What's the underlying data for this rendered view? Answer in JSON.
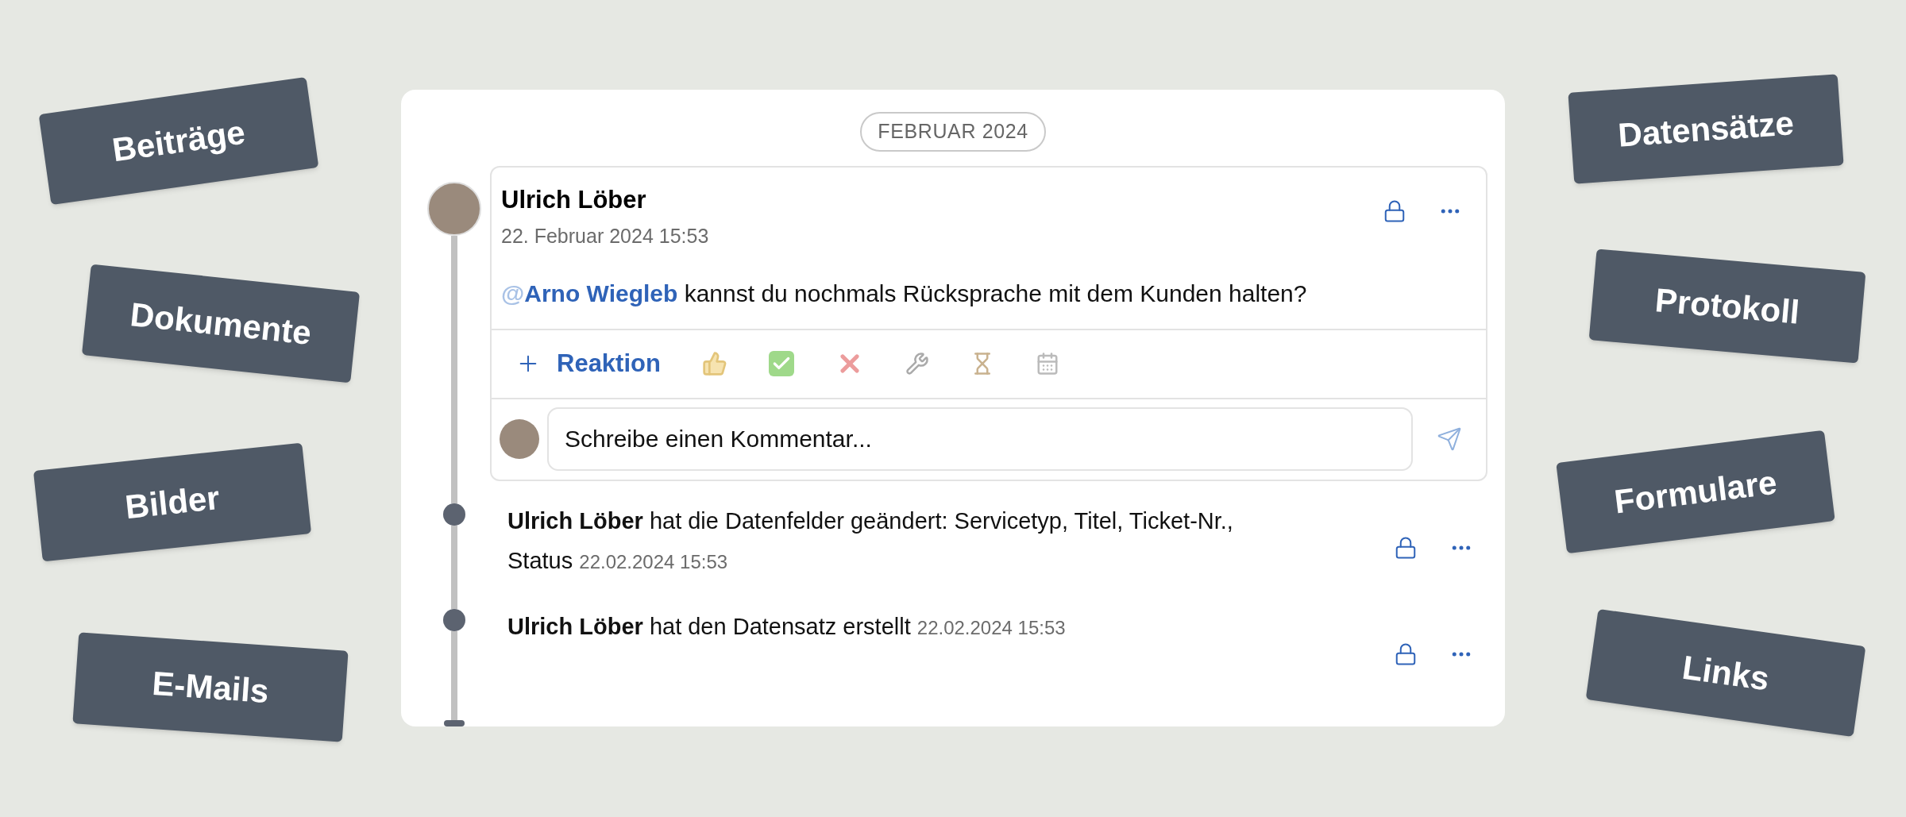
{
  "tags_left": [
    "Beiträge",
    "Dokumente",
    "Bilder",
    "E-Mails"
  ],
  "tags_right": [
    "Datensätze",
    "Protokoll",
    "Formulare",
    "Links"
  ],
  "timeline": {
    "month_badge": "FEBRUAR 2024",
    "post": {
      "author": "Ulrich Löber",
      "date": "22. Februar 2024 15:53",
      "mention": "@Arno Wiegleb",
      "message": "kannst du nochmals Rücksprache mit dem Kunden halten?",
      "reaction_label": "Reaktion",
      "comment_placeholder": "Schreibe einen Kommentar..."
    },
    "events": [
      {
        "author": "Ulrich Löber",
        "text": "hat die Datenfelder geändert: Servicetyp, Titel, Ticket-Nr., Status",
        "time": "22.02.2024 15:53"
      },
      {
        "author": "Ulrich Löber",
        "text": "hat den Datensatz erstellt",
        "time": "22.02.2024 15:53"
      }
    ]
  }
}
